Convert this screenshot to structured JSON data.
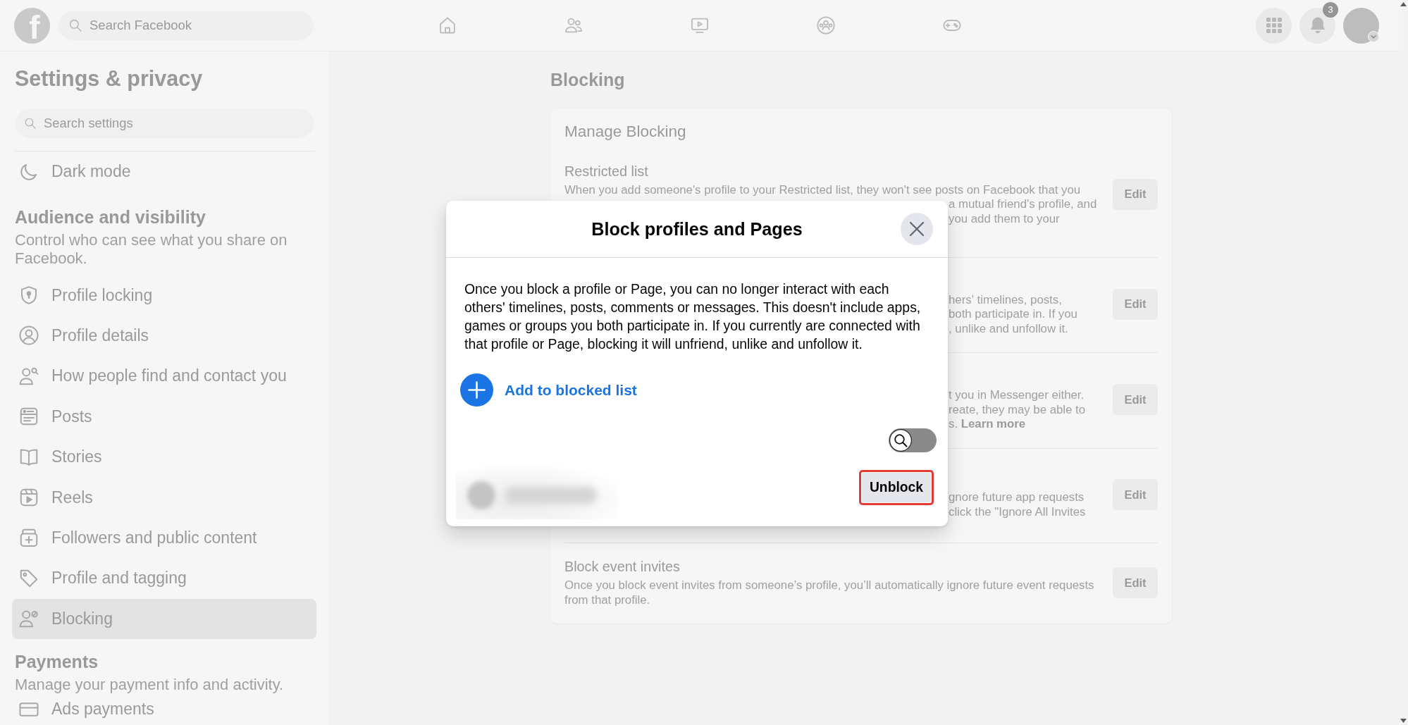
{
  "topbar": {
    "logo": "f",
    "search": {
      "placeholder": "Search Facebook"
    },
    "nav": [
      {
        "kind": "home",
        "selected": false
      },
      {
        "kind": "friends",
        "selected": false
      },
      {
        "kind": "video",
        "selected": false
      },
      {
        "kind": "groups",
        "selected": false
      },
      {
        "kind": "gaming",
        "selected": false
      }
    ],
    "notifications": {
      "badge": "3"
    }
  },
  "sidebar": {
    "title": "Settings & privacy",
    "search": {
      "placeholder": "Search settings"
    },
    "items": [
      {
        "kind": "moon",
        "label": "Dark mode",
        "selected": false
      }
    ],
    "sections": [
      {
        "heading": "Audience and visibility",
        "description": "Control who can see what you share on Facebook.",
        "items": [
          {
            "kind": "shield",
            "label": "Profile locking",
            "selected": false
          },
          {
            "kind": "profile",
            "label": "Profile details",
            "selected": false
          },
          {
            "kind": "finder",
            "label": "How people find and contact you",
            "selected": false
          },
          {
            "kind": "posts",
            "label": "Posts",
            "selected": false
          },
          {
            "kind": "book",
            "label": "Stories",
            "selected": false
          },
          {
            "kind": "reels",
            "label": "Reels",
            "selected": false
          },
          {
            "kind": "followers",
            "label": "Followers and public content",
            "selected": false
          },
          {
            "kind": "tag",
            "label": "Profile and tagging",
            "selected": false
          },
          {
            "kind": "blocking",
            "label": "Blocking",
            "selected": true
          }
        ]
      },
      {
        "heading": "Payments",
        "description": "Manage your payment info and activity.",
        "items": [
          {
            "kind": "card",
            "label": "Ads payments",
            "selected": false
          }
        ]
      }
    ]
  },
  "content": {
    "heading": "Blocking",
    "card": {
      "title": "Manage Blocking",
      "rows": [
        {
          "title": "Restricted list",
          "description": "When you add someone's profile to your Restricted list, they won't see posts on Facebook that you",
          "fragments": [
            {
              "text": "a mutual friend's profile, and"
            },
            {
              "text": "you add them to your"
            }
          ],
          "button": "Edit"
        },
        {
          "fragments": [
            {
              "text": "hers' timelines, posts,"
            },
            {
              "text": "both participate in. If you"
            },
            {
              "text": ", unlike and unfollow it."
            }
          ],
          "button": "Edit"
        },
        {
          "fragments": [
            {
              "text": "t you in Messenger either."
            },
            {
              "text": "reate, they may be able to"
            },
            {
              "text": "s.",
              "link": "Learn more"
            }
          ],
          "button": "Edit"
        },
        {
          "fragments": [
            {
              "text": "gnore future app requests"
            },
            {
              "text": "click the \"Ignore All Invites"
            }
          ],
          "button": "Edit"
        },
        {
          "title": "Block event invites",
          "description": "Once you block event invites from someone’s profile, you’ll automatically ignore future event requests from that profile.",
          "button": "Edit"
        }
      ]
    }
  },
  "dialog": {
    "title": "Block profiles and Pages",
    "body": "Once you block a profile or Page, you can no longer interact with each others' timelines, posts, comments or messages. This doesn't include apps, games or groups you both participate in. If you currently are connected with that profile or Page, blocking it will unfriend, unlike and unfollow it.",
    "add_link": "Add to blocked list",
    "toggle": {
      "on": false
    },
    "unblock_button": {
      "label": "Unblock",
      "highlighted": true
    }
  }
}
